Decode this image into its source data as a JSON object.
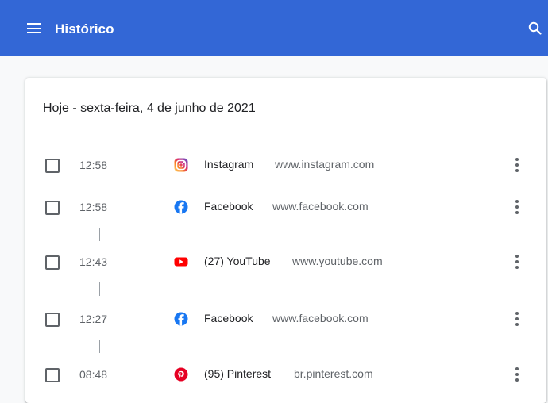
{
  "header": {
    "title": "Histórico",
    "menu_icon": "menu-icon",
    "search_icon": "search-icon",
    "background_color": "#3367d6"
  },
  "history": {
    "date_heading": "Hoje - sexta-feira, 4 de junho de 2021",
    "entries": [
      {
        "time": "12:58",
        "title": "Instagram",
        "domain": "www.instagram.com",
        "icon": "instagram-icon",
        "checked": false
      },
      {
        "time": "12:58",
        "title": "Facebook",
        "domain": "www.facebook.com",
        "icon": "facebook-icon",
        "checked": false
      },
      {
        "time": "12:43",
        "title": "(27) YouTube",
        "domain": "www.youtube.com",
        "icon": "youtube-icon",
        "checked": false
      },
      {
        "time": "12:27",
        "title": "Facebook",
        "domain": "www.facebook.com",
        "icon": "facebook-icon",
        "checked": false
      },
      {
        "time": "08:48",
        "title": "(95) Pinterest",
        "domain": "br.pinterest.com",
        "icon": "pinterest-icon",
        "checked": false
      }
    ]
  }
}
